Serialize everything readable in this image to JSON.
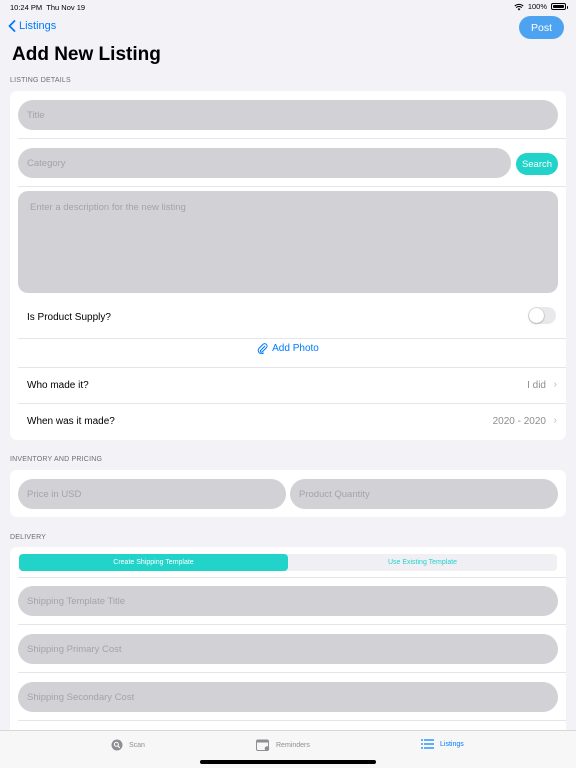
{
  "status": {
    "time": "10:24 PM",
    "date": "Thu Nov 19",
    "battery": "100%"
  },
  "nav": {
    "back_label": "Listings",
    "post_label": "Post",
    "title": "Add New Listing"
  },
  "listing": {
    "header": "LISTING DETAILS",
    "title_placeholder": "Title",
    "category_placeholder": "Category",
    "search_label": "Search",
    "description_placeholder": "Enter a description for the new listing",
    "supply_label": "Is Product Supply?",
    "supply_on": false,
    "add_photo_label": "Add Photo",
    "who_label": "Who made it?",
    "who_value": "I did",
    "when_label": "When was it made?",
    "when_value": "2020 - 2020"
  },
  "inventory": {
    "header": "INVENTORY AND PRICING",
    "price_placeholder": "Price in USD",
    "quantity_placeholder": "Product Quantity"
  },
  "delivery": {
    "header": "DELIVERY",
    "segments": [
      "Create Shipping Template",
      "Use Existing Template"
    ],
    "selected_segment": 0,
    "template_title_placeholder": "Shipping Template Title",
    "primary_cost_placeholder": "Shipping Primary Cost",
    "secondary_cost_placeholder": "Shipping Secondary Cost"
  },
  "tabs": [
    {
      "label": "Scan",
      "icon": "magnifier-icon",
      "active": false
    },
    {
      "label": "Reminders",
      "icon": "calendar-icon",
      "active": false
    },
    {
      "label": "Listings",
      "icon": "list-icon",
      "active": true
    }
  ],
  "colors": {
    "accent": "#007aff",
    "teal": "#22d3c9",
    "post": "#4ea3f0"
  }
}
